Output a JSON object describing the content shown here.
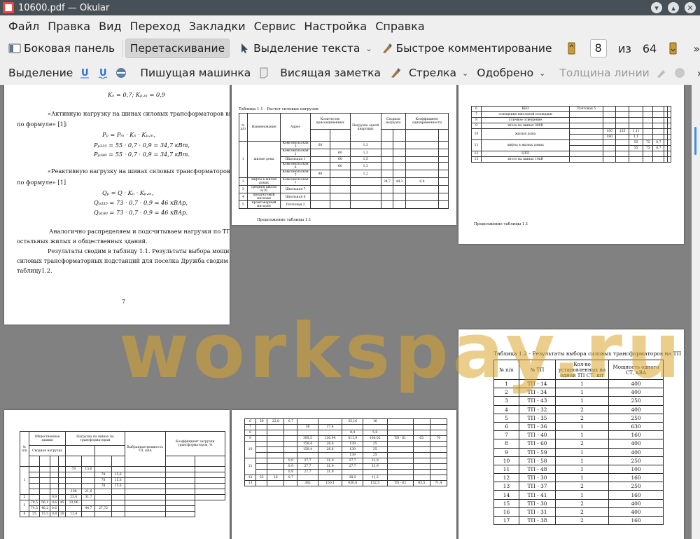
{
  "window": {
    "title": "10600.pdf  — Okular"
  },
  "menu": [
    "Файл",
    "Правка",
    "Вид",
    "Переход",
    "Закладки",
    "Сервис",
    "Настройка",
    "Справка"
  ],
  "toolbar1": {
    "sidebar": "Боковая панель",
    "drag": "Перетаскивание",
    "text_select": "Выделение текста",
    "quick_comment": "Быстрое комментирование",
    "page_current": "8",
    "page_of": "из",
    "page_total": "64"
  },
  "toolbar2": {
    "highlight": "Выделение",
    "typewriter": "Пишущая машинка",
    "note": "Висящая заметка",
    "arrow": "Стрелка",
    "stamp": "Одобрено",
    "line_width": "Толщина линии",
    "more": "»"
  },
  "page1": {
    "l1": "Kₙ = 0,7;  Kₚ.ₘ = 0,9",
    "l2": "«Активную нагрузку на шинах силовых трансформаторов вычисляем",
    "l3": "по формуле» [1]:",
    "l4": "Pₚ = Pₘ · Kₙ · Kₚ.ₘ,",
    "l5": "Pₚ₃₃₅ = 55 · 0,7 · 0,9 = 34,7 кВт,",
    "l6": "Pₚ₁₈₀ = 55 · 0,7 · 0,9 = 34,7 кВт.",
    "l7": "«Реактивную нагрузку на шинах силовых трансформаторов вычисляем",
    "l8": "по формуле» [1]",
    "l9": "Qₚ = Q · Kₙ · Kₚ.ₘ,",
    "l10": "Qₚ₃₃₅ = 73 · 0,7 · 0,9 = 46 кВАр,",
    "l11": "Qₚ₁₈₀ = 73 · 0,7 · 0,9 = 46 кВАр.",
    "l12": "Аналогично распределяем и подсчитываем нагрузки по ТП-61 и ТП-62",
    "l13": "остальных жилых и общественных зданий.",
    "l14": "Результаты сводим в таблицу 1.1. Результаты выбора мощности",
    "l15": "силовых трансформаторных подстанций для поселка Дружба сводим в",
    "l16": "таблицу1.2.",
    "page_number": "7"
  },
  "page2": {
    "caption": "Таблица 1.1 - Расчет силовых нагрузок",
    "continued": "Продолжение таблицы 1.1",
    "h_num": "№ п/п",
    "h_name": "Наименование",
    "h_addr": "Адрес",
    "h_qty": "Количество присоединенных",
    "h_load": "Нагрузка одной квартиры",
    "h_calc": "Сводная нагрузка",
    "h_coef": "Коэффициент одновременности",
    "r1_name": "жилые дома",
    "r1_a": "Комсомольская 5",
    "r1_b": "Комсомольская 1",
    "r1_c": "Школьная 1",
    "r1_d": "Комсомольская 6",
    "r1_e": "Комсомольская 7",
    "r2_name": "лифты в жилых домах",
    "r2_a": "Комсомольская 7",
    "r3_name": "средняя школа №76",
    "r3_a": "Школьная 7",
    "r4_name": "продуктовый магазин",
    "r4_a": "Школьная 6",
    "r5_name": "промтоварный магазин",
    "r5_a": "Почтовая 2"
  },
  "page3": {
    "caption": "Продолжение таблицы 1.1",
    "r6": "КБО",
    "r6_addr": "Почтовая 5",
    "r7": "освещение школьной площадки",
    "r8": "уличное освещение",
    "r9": "итого на шинах 380В",
    "r10": "жилые дома",
    "r11": "лифты в жилых домах",
    "r12": "ЦТП",
    "r13": "итого на шинах 10кВ"
  },
  "page4": {
    "caption": "Таблица 1.2 - Результаты выбора силовых трансформаторов на ТП",
    "headers": [
      "№ п/п",
      "№ ТП",
      "Кол-во установленных на одной ТП СТ, шт",
      "Мощность одного СТ, кВА"
    ],
    "rows": [
      [
        "1",
        "ТП - 14",
        "1",
        "400"
      ],
      [
        "2",
        "ТП - 34",
        "1",
        "400"
      ],
      [
        "3",
        "ТП - 43",
        "1",
        "250"
      ],
      [
        "4",
        "ТП - 32",
        "2",
        "400"
      ],
      [
        "5",
        "ТП - 35",
        "2",
        "250"
      ],
      [
        "6",
        "ТП - 36",
        "1",
        "630"
      ],
      [
        "7",
        "ТП - 40",
        "1",
        "160"
      ],
      [
        "8",
        "ТП - 60",
        "2",
        "400"
      ],
      [
        "9",
        "ТП - 59",
        "1",
        "400"
      ],
      [
        "10",
        "ТП - 58",
        "1",
        "250"
      ],
      [
        "11",
        "ТП - 48",
        "1",
        "100"
      ],
      [
        "12",
        "ТП - 30",
        "1",
        "160"
      ],
      [
        "13",
        "ТП - 37",
        "2",
        "250"
      ],
      [
        "14",
        "ТП - 41",
        "1",
        "160"
      ],
      [
        "15",
        "ТП - 30",
        "2",
        "400"
      ],
      [
        "16",
        "ТП - 31",
        "2",
        "400"
      ],
      [
        "17",
        "ТП - 38",
        "2",
        "160"
      ]
    ]
  },
  "page5": {
    "h_public": "Общественные здания",
    "h_summary": "Сводная нагрузка",
    "h_tr": "Нагрузка на шинах по трансформаторам",
    "h_select": "Выбранная мощность ТП, кВА",
    "h_coef": "Коэффициент загрузки трансформаторов, %"
  },
  "watermark": "workspay.ru"
}
